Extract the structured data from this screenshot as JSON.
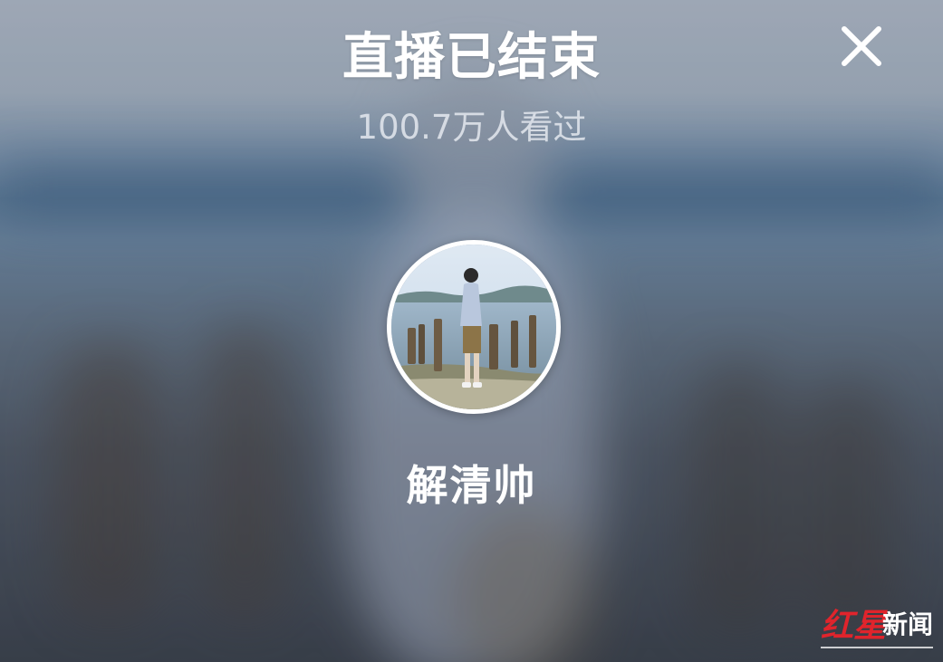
{
  "live_end": {
    "title": "直播已结束",
    "viewer_count": "100.7万人看过",
    "close_icon": "close-icon"
  },
  "streamer": {
    "name": "解清帅",
    "avatar_icon": "avatar"
  },
  "watermark": {
    "logo_text_red": "红星",
    "logo_text_white": "新闻"
  },
  "colors": {
    "title_text": "#ffffff",
    "subtitle_text": "#e8ecf2",
    "avatar_border": "#ffffff",
    "watermark_red": "#e0242c"
  }
}
